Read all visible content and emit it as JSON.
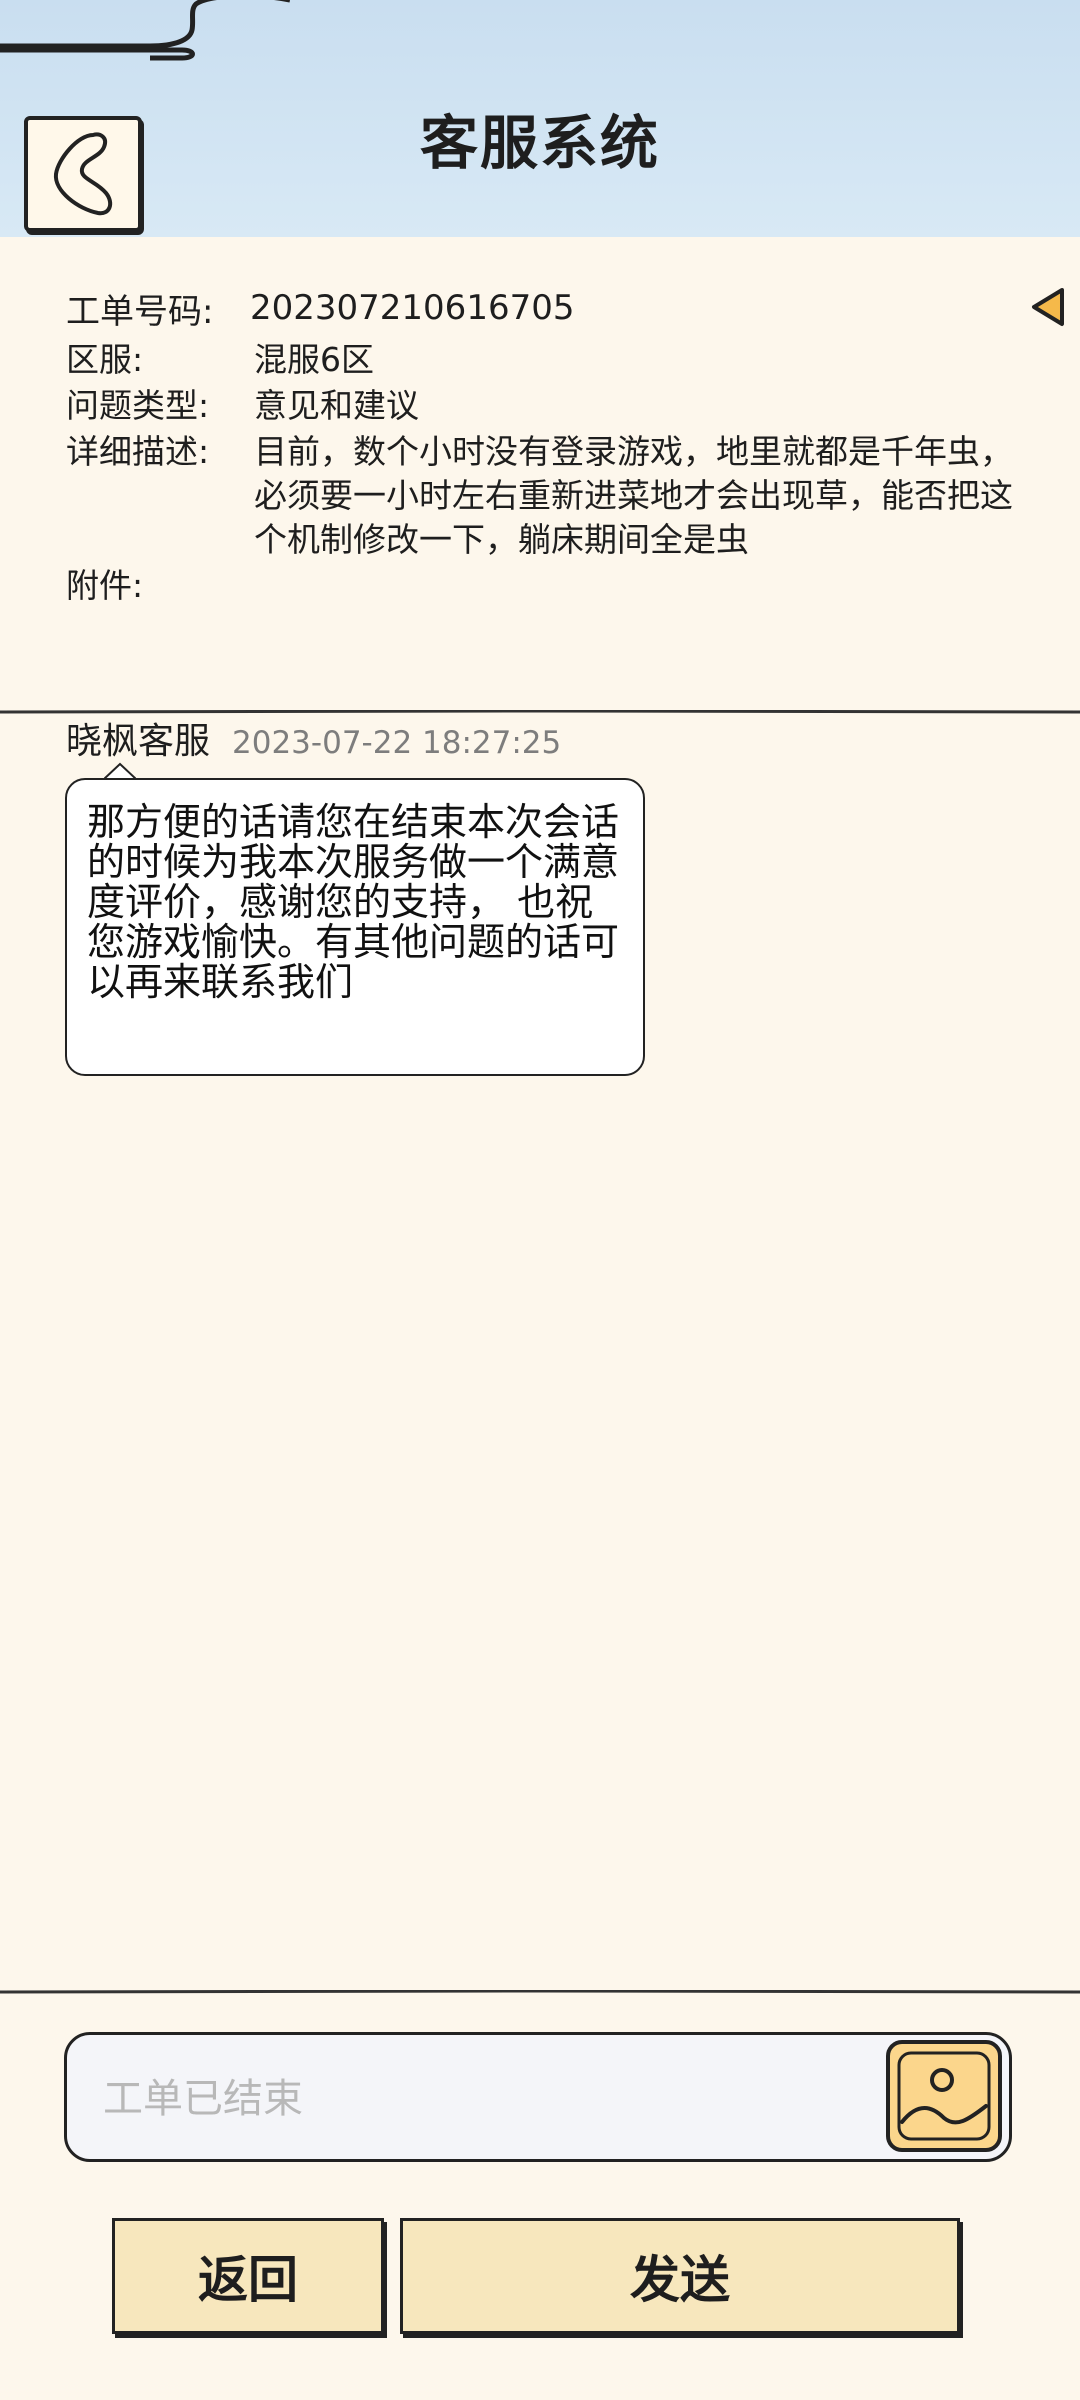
{
  "header": {
    "title": "客服系统",
    "back_icon": "chevron-left-icon"
  },
  "ticket": {
    "number_label": "工单号码:",
    "number_value": "202307210616705",
    "collapse_icon": "triangle-left-icon",
    "fields": [
      {
        "label": "区服:",
        "value": "混服6区"
      },
      {
        "label": "问题类型:",
        "value": "意见和建议"
      },
      {
        "label": "详细描述:",
        "value": "目前，数个小时没有登录游戏，地里就都是千年虫，必须要一小时左右重新进菜地才会出现草，能否把这个机制修改一下，躺床期间全是虫"
      },
      {
        "label": "附件:",
        "value": ""
      }
    ]
  },
  "chat": {
    "messages": [
      {
        "sender": "晓枫客服",
        "time": "2023-07-22 18:27:25",
        "text": "那方便的话请您在结束本次会话的时候为我本次服务做一个满意度评价，感谢您的支持， 也祝您游戏愉快。有其他问题的话可以再来联系我们"
      }
    ]
  },
  "input": {
    "placeholder": "工单已结束",
    "image_icon": "image-icon"
  },
  "buttons": {
    "back_label": "返回",
    "send_label": "发送"
  },
  "colors": {
    "page_bg": "#fdf7ec",
    "header_bg": "#cfe3f2",
    "button_bg": "#f7e7bd",
    "image_button_bg": "#fbd68c",
    "accent_orange": "#f5b94a"
  }
}
